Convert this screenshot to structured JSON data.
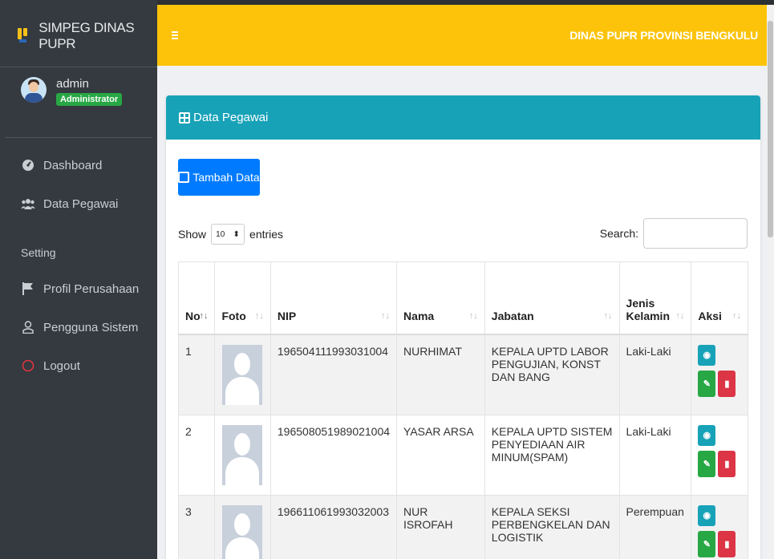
{
  "brand": {
    "title": "SIMPEG DINAS PUPR"
  },
  "user": {
    "name": "admin",
    "role": "Administrator"
  },
  "sidebar": {
    "items": [
      {
        "label": "Dashboard",
        "icon": "dashboard-icon"
      },
      {
        "label": "Data Pegawai",
        "icon": "users-icon"
      }
    ],
    "section": "Setting",
    "settings": [
      {
        "label": "Profil Perusahaan",
        "icon": "flag-icon"
      },
      {
        "label": "Pengguna Sistem",
        "icon": "user-icon"
      },
      {
        "label": "Logout",
        "icon": "power-icon"
      }
    ]
  },
  "header": {
    "title": "DINAS PUPR PROVINSI BENGKULU"
  },
  "card": {
    "title": "Data Pegawai",
    "add_label": "Tambah Data"
  },
  "table_controls": {
    "show": "Show",
    "length": "10",
    "entries": "entries",
    "search_label": "Search:"
  },
  "table": {
    "headers": [
      "No",
      "Foto",
      "NIP",
      "Nama",
      "Jabatan",
      "Jenis Kelamin",
      "Aksi"
    ],
    "rows": [
      {
        "no": "1",
        "nip": "196504111993031004",
        "nama": "NURHIMAT",
        "jabatan": "KEPALA UPTD LABOR PENGUJIAN, KONST DAN BANG",
        "jk": "Laki-Laki"
      },
      {
        "no": "2",
        "nip": "196508051989021004",
        "nama": "YASAR ARSA",
        "jabatan": "KEPALA UPTD SISTEM PENYEDIAAN AIR MINUM(SPAM)",
        "jk": "Laki-Laki"
      },
      {
        "no": "3",
        "nip": "196611061993032003",
        "nama": "NUR ISROFAH",
        "jabatan": "KEPALA SEKSI PERBENGKELAN DAN LOGISTIK",
        "jk": "Perempuan"
      }
    ]
  },
  "colors": {
    "sidebar": "#343a40",
    "header": "#fcc30a",
    "card_header": "#17a2b8",
    "primary": "#007bff"
  }
}
